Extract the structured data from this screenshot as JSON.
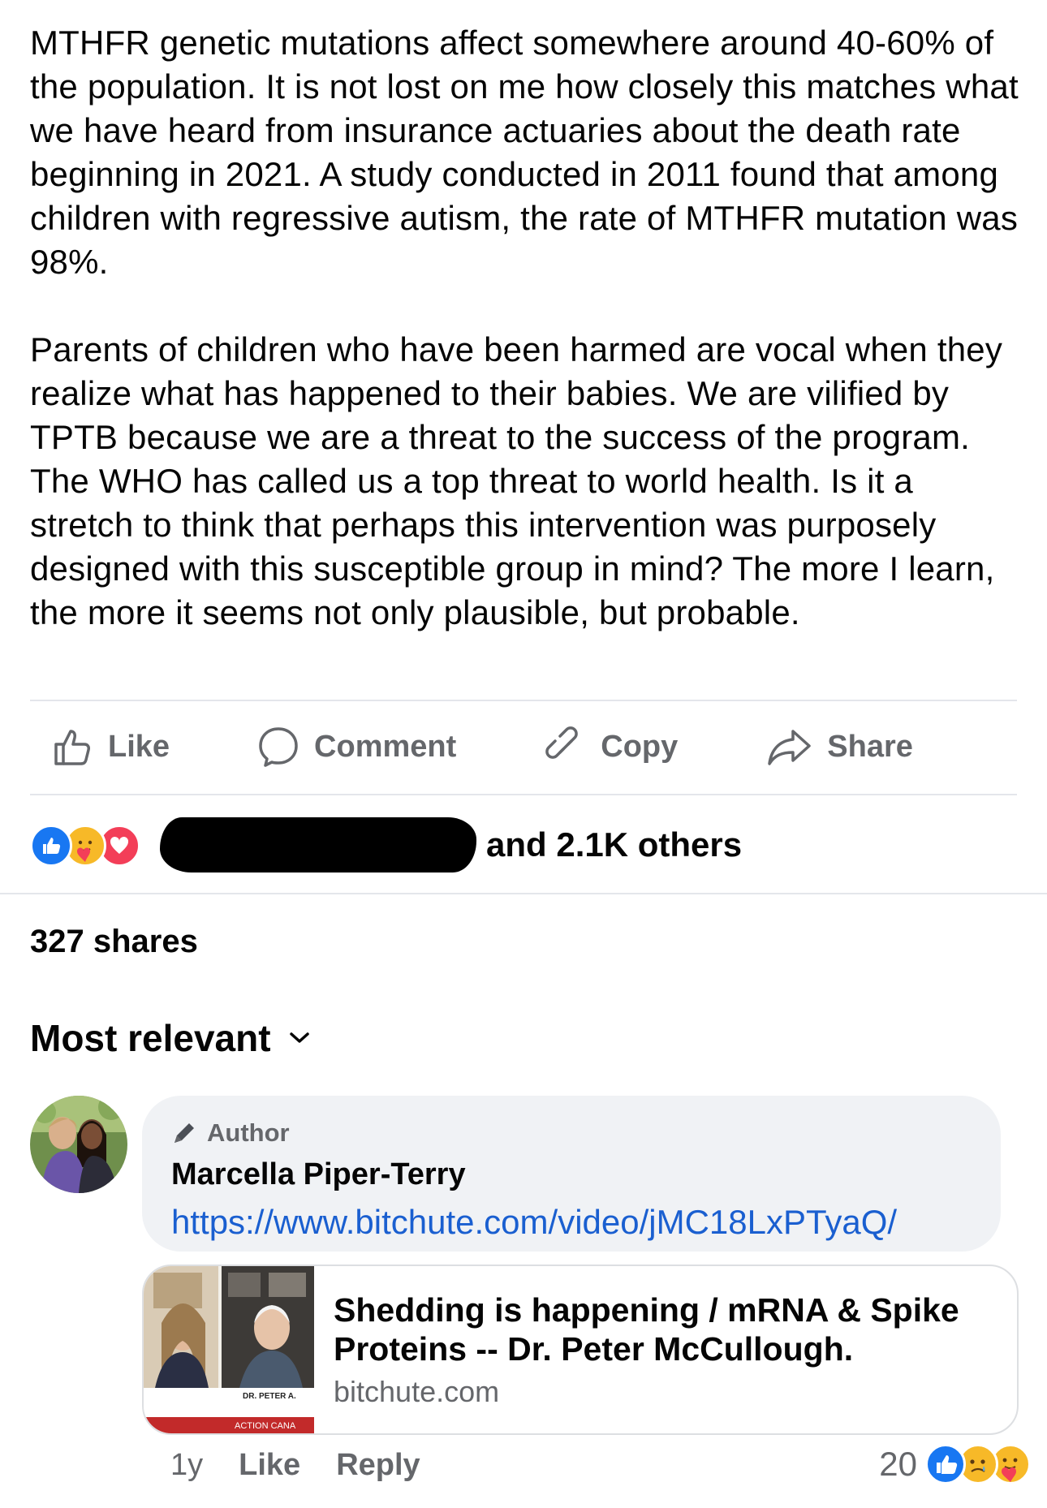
{
  "post": {
    "paragraphs": [
      "MTHFR genetic mutations affect somewhere around 40-60% of the population. It is not lost on me how closely this matches what we have heard from insurance actuaries about the death rate beginning in 2021. A study conducted in 2011 found that among children with regressive autism, the rate of MTHFR mutation was 98%.",
      "Parents of children who have been harmed are vocal when they realize what has happened to their babies. We are vilified by TPTB because we are a threat to the success of the program. The WHO has called us a top threat to world health. Is it a stretch to think that perhaps this intervention was purposely designed with this susceptible group in mind? The more I learn, the more it seems not only plausible, but probable."
    ]
  },
  "actions": {
    "like": "Like",
    "comment": "Comment",
    "copy": "Copy",
    "share": "Share"
  },
  "reactions": {
    "icons": [
      "like-icon",
      "care-icon",
      "love-icon"
    ],
    "others_text": "and 2.1K others"
  },
  "shares_text": "327 shares",
  "sort_label": "Most relevant",
  "comment": {
    "author_badge": "Author",
    "author_name": "Marcella Piper-Terry",
    "link_text": "https://www.bitchute.com/video/jMC18LxPTyaQ/",
    "card": {
      "title": "Shedding is happening / mRNA & Spike Proteins -- Dr. Peter McCullough.",
      "domain": "bitchute.com",
      "thumb_caption": "DR. PETER A.",
      "thumb_banner": "ACTION CANA"
    },
    "time": "1y",
    "like_label": "Like",
    "reply_label": "Reply",
    "reaction_count": "20",
    "reaction_icons": [
      "like-icon",
      "sad-icon",
      "care-icon"
    ]
  },
  "colors": {
    "text": "#050505",
    "secondary": "#65676b",
    "link": "#1a5fd0",
    "like_blue": "#1877f2",
    "love_red": "#f33e58",
    "emoji_yellow": "#f7b928",
    "bubble_bg": "#f0f2f5"
  }
}
